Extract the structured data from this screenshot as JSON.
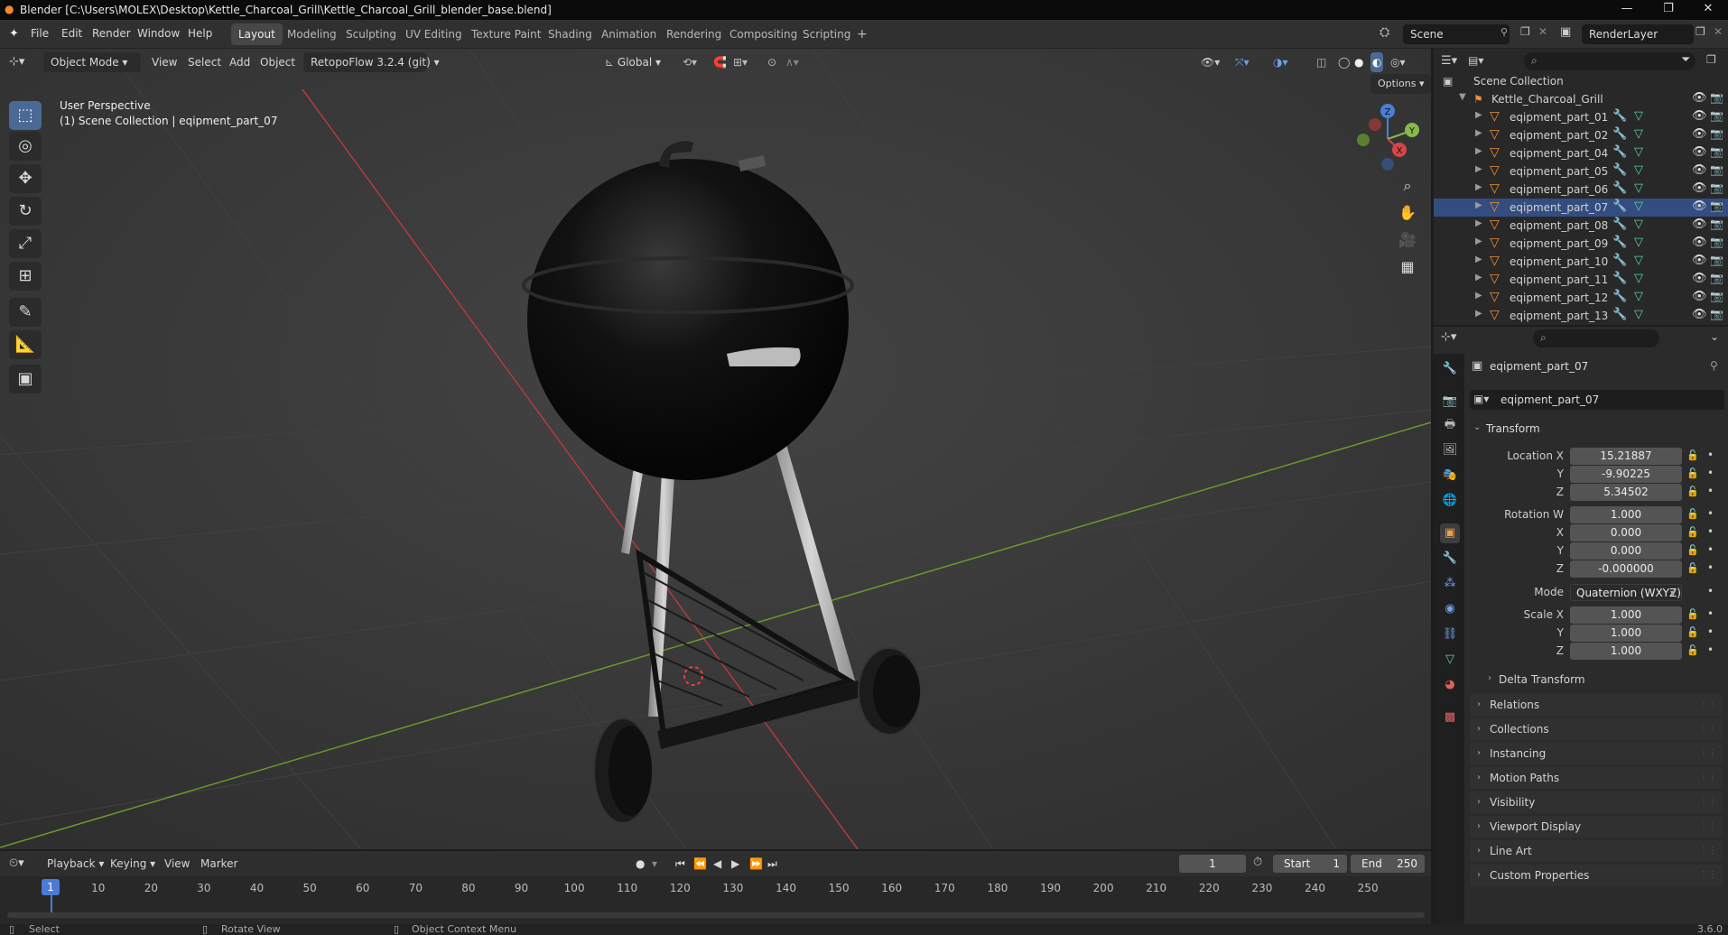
{
  "titlebar": {
    "title": "Blender [C:\\Users\\MOLEX\\Desktop\\Kettle_Charcoal_Grill\\Kettle_Charcoal_Grill_blender_base.blend]"
  },
  "menus": [
    "File",
    "Edit",
    "Render",
    "Window",
    "Help"
  ],
  "workspaces": [
    "Layout",
    "Modeling",
    "Sculpting",
    "UV Editing",
    "Texture Paint",
    "Shading",
    "Animation",
    "Rendering",
    "Compositing",
    "Scripting"
  ],
  "workspace_add": "+",
  "scene": {
    "name": "Scene",
    "view_layer": "RenderLayer"
  },
  "viewport": {
    "mode": "Object Mode",
    "menus": [
      "View",
      "Select",
      "Add",
      "Object"
    ],
    "addon": "RetopoFlow 3.2.4 (git)",
    "orientation": "Global",
    "options": "Options",
    "overlay_title": "User Perspective",
    "overlay_subtitle": "(1) Scene Collection | eqipment_part_07",
    "gizmo": {
      "x": "X",
      "y": "Y",
      "z": "Z"
    }
  },
  "outliner": {
    "root": "Scene Collection",
    "collection": "Kettle_Charcoal_Grill",
    "items": [
      "eqipment_part_01",
      "eqipment_part_02",
      "eqipment_part_04",
      "eqipment_part_05",
      "eqipment_part_06",
      "eqipment_part_07",
      "eqipment_part_08",
      "eqipment_part_09",
      "eqipment_part_10",
      "eqipment_part_11",
      "eqipment_part_12",
      "eqipment_part_13"
    ],
    "selected_index": 5
  },
  "properties": {
    "object_name": "eqipment_part_07",
    "datablock_name": "eqipment_part_07",
    "transform_label": "Transform",
    "location": {
      "label_x": "Location X",
      "label_y": "Y",
      "label_z": "Z",
      "x": "15.21887",
      "y": "-9.90225",
      "z": "5.34502"
    },
    "rotation": {
      "label_w": "Rotation W",
      "label_x": "X",
      "label_y": "Y",
      "label_z": "Z",
      "w": "1.000",
      "x": "0.000",
      "y": "0.000",
      "z": "-0.000000"
    },
    "mode": {
      "label": "Mode",
      "value": "Quaternion (WXYZ)"
    },
    "scale": {
      "label_x": "Scale X",
      "label_y": "Y",
      "label_z": "Z",
      "x": "1.000",
      "y": "1.000",
      "z": "1.000"
    },
    "delta_transform": "Delta Transform",
    "panels": [
      "Relations",
      "Collections",
      "Instancing",
      "Motion Paths",
      "Visibility",
      "Viewport Display",
      "Line Art",
      "Custom Properties"
    ]
  },
  "timeline": {
    "menus": [
      "Playback",
      "Keying",
      "View",
      "Marker"
    ],
    "current_frame": "1",
    "start_label": "Start",
    "start": "1",
    "end_label": "End",
    "end": "250",
    "ruler": [
      "10",
      "20",
      "30",
      "40",
      "50",
      "60",
      "70",
      "80",
      "90",
      "100",
      "110",
      "120",
      "130",
      "140",
      "150",
      "160",
      "170",
      "180",
      "190",
      "200",
      "210",
      "220",
      "230",
      "240",
      "250"
    ],
    "playhead": "1"
  },
  "status": {
    "select": "Select",
    "rotate": "Rotate View",
    "context": "Object Context Menu",
    "version": "3.6.0"
  }
}
